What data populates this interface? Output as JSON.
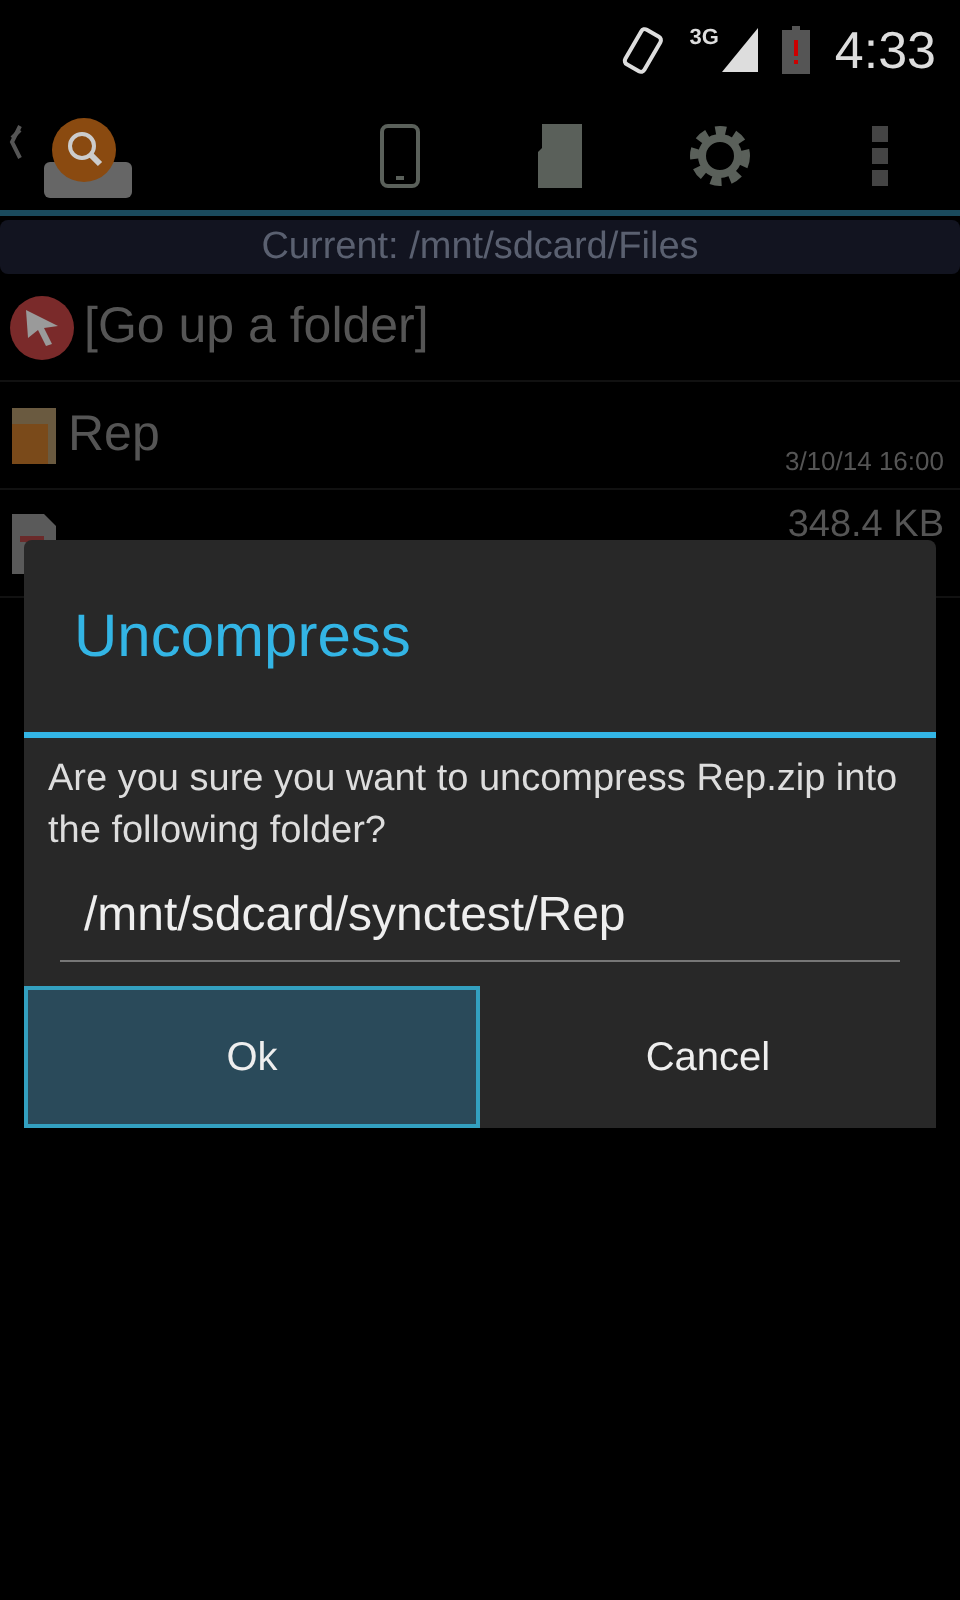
{
  "status_bar": {
    "time": "4:33",
    "network": "3G"
  },
  "toolbar": {
    "current_path": "Current: /mnt/sdcard/Files"
  },
  "files": [
    {
      "kind": "up",
      "name": "[Go up a folder]"
    },
    {
      "kind": "folder",
      "name": "Rep",
      "date": "3/10/14 16:00"
    },
    {
      "kind": "pdf",
      "size": "348.4 KB"
    }
  ],
  "dialog": {
    "title": "Uncompress",
    "message": "Are you sure you want to uncompress Rep.zip into the following folder?",
    "value": "/mnt/sdcard/synctest/Rep",
    "buttons": [
      {
        "label": "Ok",
        "selected": true
      },
      {
        "label": "Cancel",
        "selected": false
      }
    ]
  }
}
